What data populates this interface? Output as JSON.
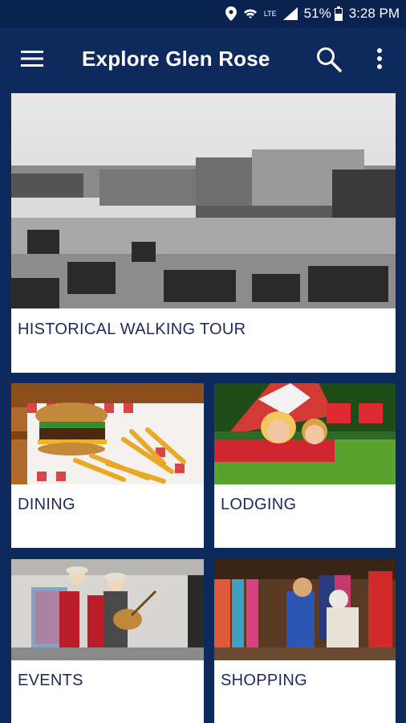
{
  "status": {
    "battery": "51%",
    "time": "3:28 PM",
    "network": "LTE"
  },
  "appbar": {
    "title": "Explore Glen Rose",
    "icons": [
      "menu-icon",
      "search-icon",
      "more-vert-icon"
    ]
  },
  "cards": [
    {
      "label": "HISTORICAL WALKING TOUR",
      "image": "historic-town-square-photo"
    },
    {
      "label": "DINING",
      "image": "burger-fries-photo"
    },
    {
      "label": "LODGING",
      "image": "camping-tent-photo"
    },
    {
      "label": "EVENTS",
      "image": "live-music-band-photo"
    },
    {
      "label": "SHOPPING",
      "image": "boutique-shopping-photo"
    }
  ],
  "colors": {
    "app_bar": "#0e2a5c",
    "status_bar": "#0a2250",
    "label_text": "#1c2a5a"
  }
}
